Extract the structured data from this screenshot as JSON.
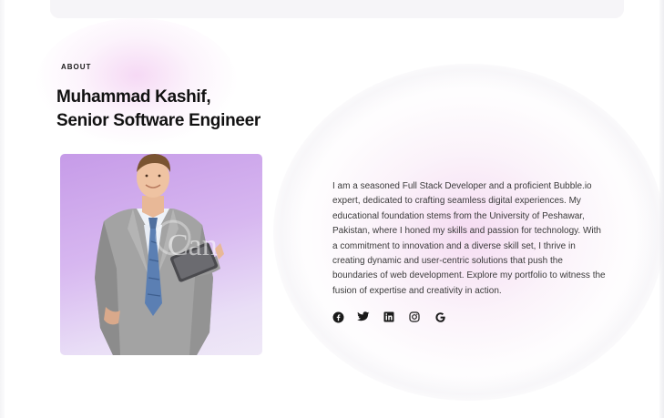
{
  "about": {
    "eyebrow": "ABOUT",
    "headline_line1": "Muhammad Kashif,",
    "headline_line2": "Senior Software Engineer",
    "photo_alt": "Portrait of a man in a grey suit holding a tablet",
    "watermark": "Can",
    "bio": "I am a seasoned Full Stack Developer and a proficient Bubble.io expert, dedicated to crafting seamless digital experiences. My educational foundation stems from the University of Peshawar, Pakistan, where I honed my skills and passion for technology. With a commitment to innovation and a diverse skill set, I thrive in creating dynamic and user-centric solutions that push the boundaries of web development. Explore my portfolio to witness the fusion of expertise and creativity in action."
  },
  "socials": [
    {
      "icon": "facebook-icon"
    },
    {
      "icon": "twitter-icon"
    },
    {
      "icon": "linkedin-icon"
    },
    {
      "icon": "instagram-icon"
    },
    {
      "icon": "google-icon"
    }
  ],
  "colors": {
    "text": "#111111",
    "body_text": "#3a3a3a",
    "photo_bg_top": "#c69be8",
    "photo_bg_bottom": "#efe9f7",
    "glow": "#f2d0ee"
  }
}
